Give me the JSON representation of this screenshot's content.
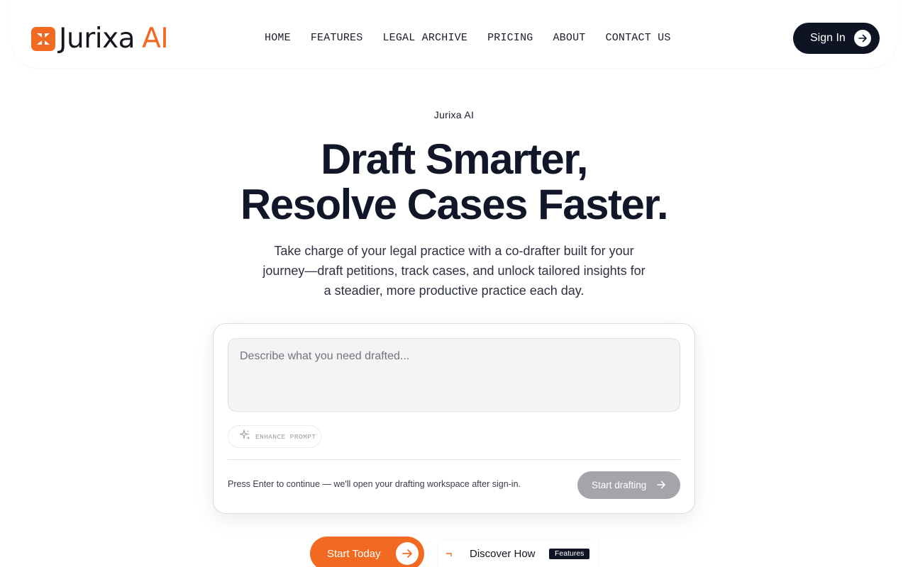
{
  "brand": {
    "name_primary": "Jurixa",
    "name_accent": "AI",
    "accent_color": "#f26a21",
    "dark_color": "#0f1424"
  },
  "nav": {
    "items": [
      {
        "label": "HOME"
      },
      {
        "label": "FEATURES"
      },
      {
        "label": "LEGAL ARCHIVE"
      },
      {
        "label": "PRICING"
      },
      {
        "label": "ABOUT"
      },
      {
        "label": "CONTACT US"
      }
    ],
    "signin_label": "Sign In"
  },
  "hero": {
    "eyebrow": "Jurixa AI",
    "headline_line1": "Draft Smarter,",
    "headline_line2": "Resolve Cases Faster.",
    "subtext": "Take charge of your legal practice with a co-drafter built for your journey—draft petitions, track cases, and unlock tailored insights for a steadier, more productive practice each day."
  },
  "composer": {
    "placeholder": "Describe what you need drafted...",
    "enhance_label": "ENHANCE PROMPT",
    "hint": "Press Enter to continue — we'll open your drafting workspace after sign-in.",
    "submit_label": "Start drafting"
  },
  "cta": {
    "primary_label": "Start Today",
    "secondary_label": "Discover How",
    "secondary_badge": "Features"
  },
  "icons": {
    "logo": "logo-mark-icon",
    "signin_arrow": "arrow-right-icon",
    "enhance": "sparkle-icon",
    "submit_arrow": "arrow-right-icon",
    "primary_arrow": "arrow-right-icon"
  }
}
